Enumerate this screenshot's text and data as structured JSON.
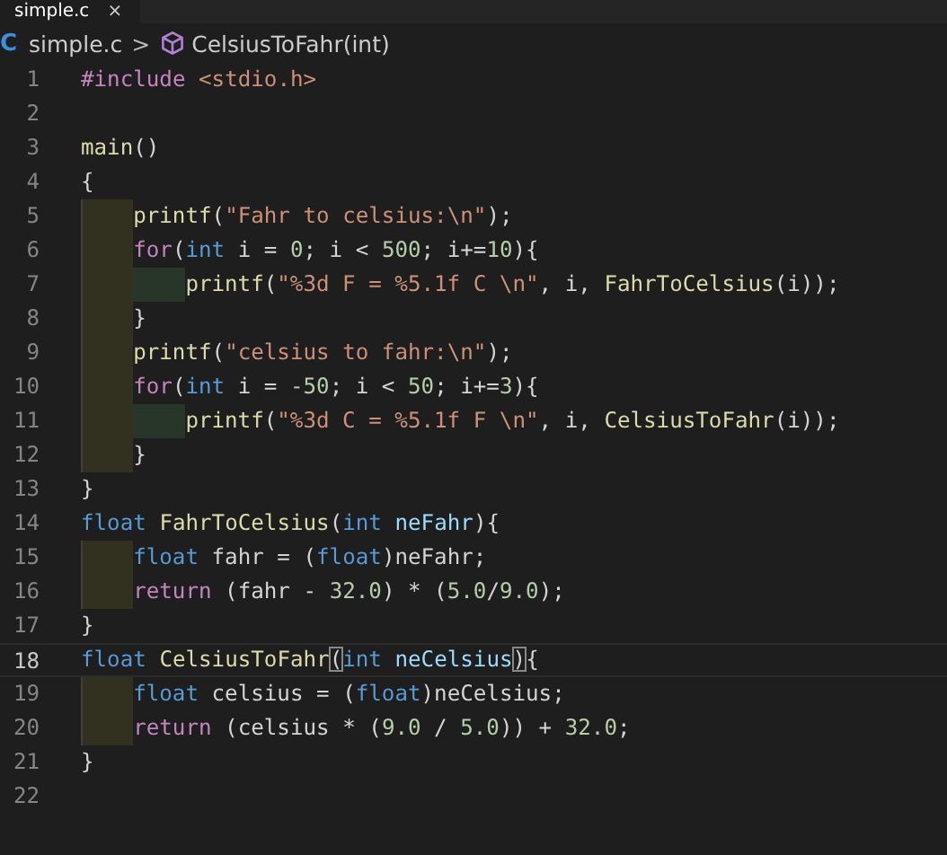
{
  "tab": {
    "label": "simple.c",
    "close": "×"
  },
  "breadcrumb": {
    "file_icon": "C",
    "file": "simple.c",
    "separator": ">",
    "symbol": "CelsiusToFahr(int)"
  },
  "lines": [
    {
      "number": "1",
      "current": false,
      "tokens": [
        {
          "kind": "directive",
          "text": "#include "
        },
        {
          "kind": "string",
          "text": "<stdio.h>"
        }
      ]
    },
    {
      "number": "2",
      "current": false
    },
    {
      "number": "3",
      "current": false,
      "tokens": [
        {
          "kind": "function",
          "text": "main"
        },
        {
          "kind": "plain",
          "text": "()"
        }
      ]
    },
    {
      "number": "4",
      "current": false,
      "tokens": [
        {
          "kind": "plain",
          "text": "{"
        }
      ]
    },
    {
      "number": "5",
      "current": false,
      "indent_guides": [
        {
          "color": "#32311f"
        }
      ],
      "tokens": [
        {
          "kind": "function",
          "text": "printf"
        },
        {
          "kind": "plain",
          "text": "("
        },
        {
          "kind": "string",
          "text": "\"Fahr to celsius:\\n\""
        },
        {
          "kind": "plain",
          "text": ");"
        }
      ]
    },
    {
      "number": "6",
      "current": false,
      "indent_guides": [
        {
          "color": "#32311f"
        }
      ],
      "tokens": [
        {
          "kind": "control",
          "text": "for"
        },
        {
          "kind": "plain",
          "text": "("
        },
        {
          "kind": "type",
          "text": "int"
        },
        {
          "kind": "plain",
          "text": " i = "
        },
        {
          "kind": "number",
          "text": "0"
        },
        {
          "kind": "plain",
          "text": "; i < "
        },
        {
          "kind": "number",
          "text": "500"
        },
        {
          "kind": "plain",
          "text": "; i+="
        },
        {
          "kind": "number",
          "text": "10"
        },
        {
          "kind": "plain",
          "text": "){"
        }
      ]
    },
    {
      "number": "7",
      "current": false,
      "indent_guides": [
        {
          "color": "#32311f"
        },
        {
          "color": "#283529"
        }
      ],
      "tokens": [
        {
          "kind": "function",
          "text": "printf"
        },
        {
          "kind": "plain",
          "text": "("
        },
        {
          "kind": "string",
          "text": "\"%3d F = %5.1f C \\n\""
        },
        {
          "kind": "plain",
          "text": ", i, "
        },
        {
          "kind": "function",
          "text": "FahrToCelsius"
        },
        {
          "kind": "plain",
          "text": "(i));"
        }
      ]
    },
    {
      "number": "8",
      "current": false,
      "indent_guides": [
        {
          "color": "#32311f"
        }
      ],
      "tokens": [
        {
          "kind": "plain",
          "text": "}"
        }
      ]
    },
    {
      "number": "9",
      "current": false,
      "indent_guides": [
        {
          "color": "#32311f"
        }
      ],
      "tokens": [
        {
          "kind": "function",
          "text": "printf"
        },
        {
          "kind": "plain",
          "text": "("
        },
        {
          "kind": "string",
          "text": "\"celsius to fahr:\\n\""
        },
        {
          "kind": "plain",
          "text": ");"
        }
      ]
    },
    {
      "number": "10",
      "current": false,
      "indent_guides": [
        {
          "color": "#32311f"
        }
      ],
      "tokens": [
        {
          "kind": "control",
          "text": "for"
        },
        {
          "kind": "plain",
          "text": "("
        },
        {
          "kind": "type",
          "text": "int"
        },
        {
          "kind": "plain",
          "text": " i = "
        },
        {
          "kind": "number",
          "text": "-50"
        },
        {
          "kind": "plain",
          "text": "; i < "
        },
        {
          "kind": "number",
          "text": "50"
        },
        {
          "kind": "plain",
          "text": "; i+="
        },
        {
          "kind": "number",
          "text": "3"
        },
        {
          "kind": "plain",
          "text": "){"
        }
      ]
    },
    {
      "number": "11",
      "current": false,
      "indent_guides": [
        {
          "color": "#32311f"
        },
        {
          "color": "#283529"
        }
      ],
      "tokens": [
        {
          "kind": "function",
          "text": "printf"
        },
        {
          "kind": "plain",
          "text": "("
        },
        {
          "kind": "string",
          "text": "\"%3d C = %5.1f F \\n\""
        },
        {
          "kind": "plain",
          "text": ", i, "
        },
        {
          "kind": "function",
          "text": "CelsiusToFahr"
        },
        {
          "kind": "plain",
          "text": "(i));"
        }
      ]
    },
    {
      "number": "12",
      "current": false,
      "indent_guides": [
        {
          "color": "#32311f"
        }
      ],
      "tokens": [
        {
          "kind": "plain",
          "text": "}"
        }
      ]
    },
    {
      "number": "13",
      "current": false,
      "tokens": [
        {
          "kind": "plain",
          "text": "}"
        }
      ]
    },
    {
      "number": "14",
      "current": false,
      "tokens": [
        {
          "kind": "type",
          "text": "float "
        },
        {
          "kind": "function",
          "text": "FahrToCelsius"
        },
        {
          "kind": "plain",
          "text": "("
        },
        {
          "kind": "type",
          "text": "int "
        },
        {
          "kind": "parameter",
          "text": "neFahr"
        },
        {
          "kind": "plain",
          "text": "){"
        }
      ]
    },
    {
      "number": "15",
      "current": false,
      "indent_guides": [
        {
          "color": "#32311f"
        }
      ],
      "tokens": [
        {
          "kind": "type",
          "text": "float"
        },
        {
          "kind": "plain",
          "text": " fahr = ("
        },
        {
          "kind": "type",
          "text": "float"
        },
        {
          "kind": "plain",
          "text": ")neFahr;"
        }
      ]
    },
    {
      "number": "16",
      "current": false,
      "indent_guides": [
        {
          "color": "#32311f"
        }
      ],
      "tokens": [
        {
          "kind": "control",
          "text": "return"
        },
        {
          "kind": "plain",
          "text": " (fahr - "
        },
        {
          "kind": "number",
          "text": "32.0"
        },
        {
          "kind": "plain",
          "text": ") * ("
        },
        {
          "kind": "number",
          "text": "5.0"
        },
        {
          "kind": "plain",
          "text": "/"
        },
        {
          "kind": "number",
          "text": "9.0"
        },
        {
          "kind": "plain",
          "text": ");"
        }
      ]
    },
    {
      "number": "17",
      "current": false,
      "tokens": [
        {
          "kind": "plain",
          "text": "}"
        }
      ]
    },
    {
      "number": "18",
      "current": true,
      "tokens": [
        {
          "kind": "type",
          "text": "float "
        },
        {
          "kind": "function",
          "text": "CelsiusToFahr"
        },
        {
          "kind": "bracket_match",
          "text": "("
        },
        {
          "kind": "type",
          "text": "int "
        },
        {
          "kind": "parameter",
          "text": "neCelsius"
        },
        {
          "kind": "bracket_match",
          "text": ")"
        },
        {
          "kind": "plain",
          "text": "{"
        }
      ]
    },
    {
      "number": "19",
      "current": false,
      "indent_guides": [
        {
          "color": "#32311f"
        }
      ],
      "tokens": [
        {
          "kind": "type",
          "text": "float"
        },
        {
          "kind": "plain",
          "text": " celsius = ("
        },
        {
          "kind": "type",
          "text": "float"
        },
        {
          "kind": "plain",
          "text": ")neCelsius;"
        }
      ]
    },
    {
      "number": "20",
      "current": false,
      "indent_guides": [
        {
          "color": "#32311f"
        }
      ],
      "tokens": [
        {
          "kind": "control",
          "text": "return"
        },
        {
          "kind": "plain",
          "text": " (celsius * ("
        },
        {
          "kind": "number",
          "text": "9.0"
        },
        {
          "kind": "plain",
          "text": " / "
        },
        {
          "kind": "number",
          "text": "5.0"
        },
        {
          "kind": "plain",
          "text": ")) + "
        },
        {
          "kind": "number",
          "text": "32.0"
        },
        {
          "kind": "plain",
          "text": ";"
        }
      ]
    },
    {
      "number": "21",
      "current": false,
      "tokens": [
        {
          "kind": "plain",
          "text": "}"
        }
      ]
    },
    {
      "number": "22",
      "current": false
    }
  ]
}
